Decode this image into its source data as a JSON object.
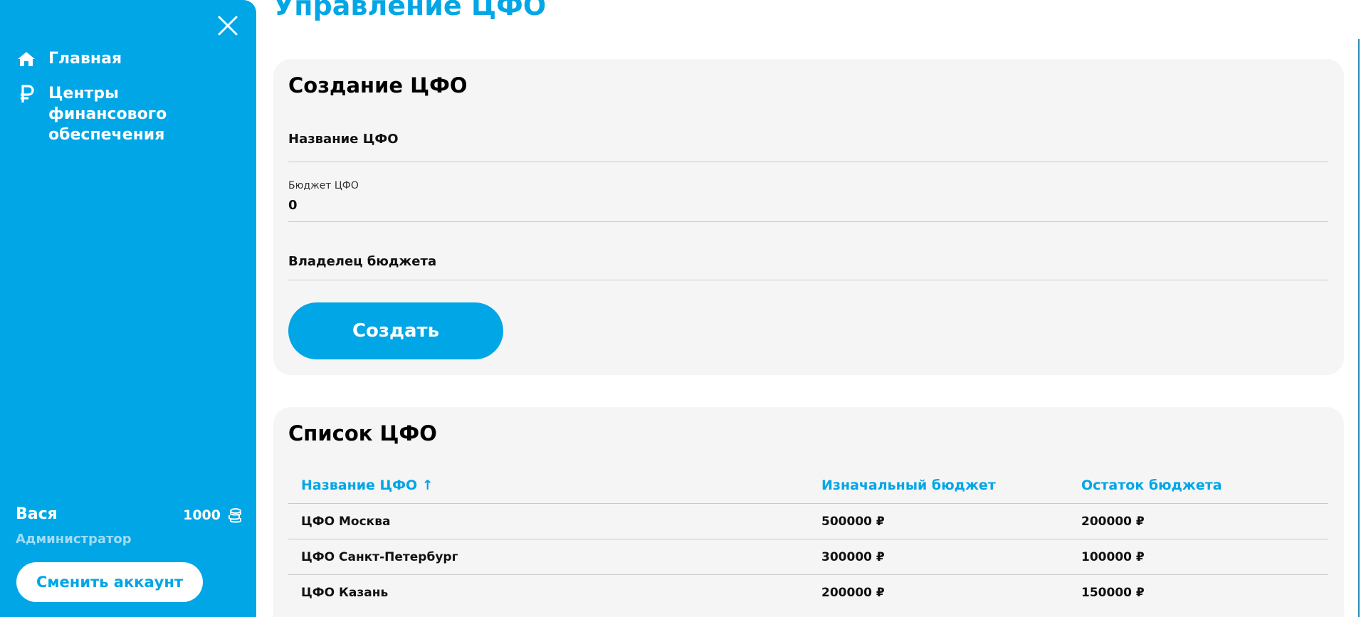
{
  "sidebar": {
    "nav": [
      {
        "label": "Главная",
        "icon": "home-icon"
      },
      {
        "label": "Центры финансового обеспечения",
        "icon": "ruble-icon"
      }
    ],
    "user": {
      "name": "Вася",
      "role": "Администратор",
      "balance": "1000",
      "balance_icon": "coins-icon"
    },
    "switch_account_label": "Сменить аккаунт"
  },
  "page": {
    "title": "Управление ЦФО"
  },
  "create_form": {
    "title": "Создание ЦФО",
    "name_label": "Название ЦФО",
    "name_value": "",
    "budget_label": "Бюджет ЦФО",
    "budget_value": "0",
    "owner_label": "Владелец бюджета",
    "owner_value": "",
    "submit_label": "Создать"
  },
  "list": {
    "title": "Список ЦФО",
    "columns": [
      "Название ЦФО ↑",
      "Изначальный бюджет",
      "Остаток бюджета"
    ],
    "rows": [
      [
        "ЦФО Москва",
        "500000 ₽",
        "200000 ₽"
      ],
      [
        "ЦФО Санкт-Петербург",
        "300000 ₽",
        "100000 ₽"
      ],
      [
        "ЦФО Казань",
        "200000 ₽",
        "150000 ₽"
      ]
    ]
  },
  "colors": {
    "accent": "#00A6E6",
    "card_bg": "#f5f5f5",
    "role_text": "#9fdcf5"
  }
}
